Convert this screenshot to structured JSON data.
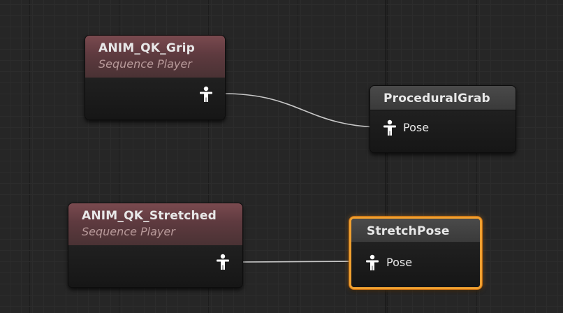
{
  "graph": {
    "nodes": [
      {
        "id": "grip",
        "title": "ANIM_QK_Grip",
        "subtitle": "Sequence Player"
      },
      {
        "id": "procedural_grab",
        "title": "ProceduralGrab",
        "pin_label": "Pose"
      },
      {
        "id": "stretched",
        "title": "ANIM_QK_Stretched",
        "subtitle": "Sequence Player"
      },
      {
        "id": "stretch_pose",
        "title": "StretchPose",
        "pin_label": "Pose",
        "selected": true
      }
    ],
    "icons": {
      "pose_pin": "pose-figure-icon"
    },
    "colors": {
      "wire": "#c8c8c8",
      "selection": "#f0a030",
      "sequence_header": "#6b4247"
    }
  }
}
